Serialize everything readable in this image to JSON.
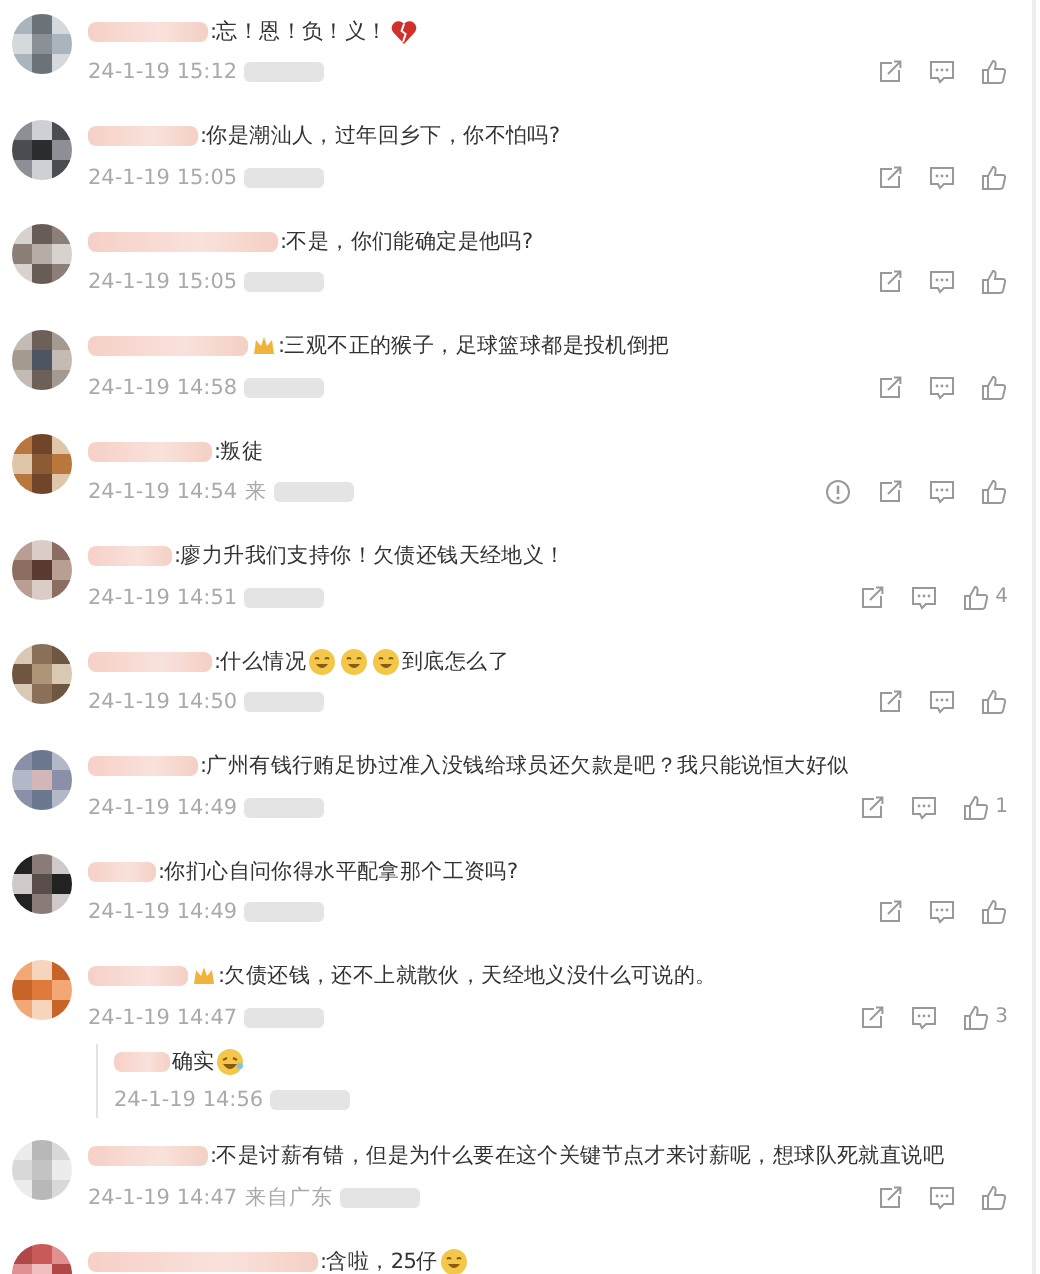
{
  "comments": [
    {
      "badge": false,
      "parts": [
        {
          "kind": "text",
          "text": ":忘！恩！负！义！"
        },
        {
          "kind": "broken-heart"
        }
      ],
      "time": "24-1-19 15:12",
      "actions": [
        {
          "kind": "share"
        },
        {
          "kind": "comment"
        },
        {
          "kind": "like"
        }
      ]
    },
    {
      "badge": false,
      "parts": [
        {
          "kind": "text",
          "text": ":你是潮汕人，过年回乡下，你不怕吗?"
        }
      ],
      "time": "24-1-19 15:05",
      "actions": [
        {
          "kind": "share"
        },
        {
          "kind": "comment"
        },
        {
          "kind": "like"
        }
      ]
    },
    {
      "badge": false,
      "parts": [
        {
          "kind": "text",
          "text": ":不是，你们能确定是他吗?"
        }
      ],
      "time": "24-1-19 15:05",
      "actions": [
        {
          "kind": "share"
        },
        {
          "kind": "comment"
        },
        {
          "kind": "like"
        }
      ]
    },
    {
      "badge": true,
      "parts": [
        {
          "kind": "text",
          "text": ":三观不正的猴子，足球篮球都是投机倒把"
        }
      ],
      "time": "24-1-19 14:58",
      "actions": [
        {
          "kind": "share"
        },
        {
          "kind": "comment"
        },
        {
          "kind": "like"
        }
      ]
    },
    {
      "badge": false,
      "parts": [
        {
          "kind": "text",
          "text": ":叛徒"
        }
      ],
      "time": "24-1-19 14:54",
      "location": "来",
      "actions": [
        {
          "kind": "report"
        },
        {
          "kind": "share"
        },
        {
          "kind": "comment"
        },
        {
          "kind": "like"
        }
      ]
    },
    {
      "badge": false,
      "parts": [
        {
          "kind": "text",
          "text": ":廖力升我们支持你！欠债还钱天经地义！"
        }
      ],
      "time": "24-1-19 14:51",
      "actions": [
        {
          "kind": "share"
        },
        {
          "kind": "comment"
        },
        {
          "kind": "like",
          "count": "4"
        }
      ]
    },
    {
      "badge": false,
      "parts": [
        {
          "kind": "text",
          "text": ":什么情况"
        },
        {
          "kind": "smile"
        },
        {
          "kind": "smile"
        },
        {
          "kind": "smile"
        },
        {
          "kind": "text",
          "text": "到底怎么了"
        }
      ],
      "time": "24-1-19 14:50",
      "actions": [
        {
          "kind": "share"
        },
        {
          "kind": "comment"
        },
        {
          "kind": "like"
        }
      ]
    },
    {
      "badge": false,
      "parts": [
        {
          "kind": "text",
          "text": ":广州有钱行贿足协过准入没钱给球员还欠款是吧？我只能说恒大好似"
        }
      ],
      "time": "24-1-19 14:49",
      "actions": [
        {
          "kind": "share"
        },
        {
          "kind": "comment"
        },
        {
          "kind": "like",
          "count": "1"
        }
      ]
    },
    {
      "badge": false,
      "parts": [
        {
          "kind": "text",
          "text": ":你扪心自问你得水平配拿那个工资吗?"
        }
      ],
      "time": "24-1-19 14:49",
      "actions": [
        {
          "kind": "share"
        },
        {
          "kind": "comment"
        },
        {
          "kind": "like"
        }
      ]
    },
    {
      "badge": true,
      "parts": [
        {
          "kind": "text",
          "text": ":欠债还钱，还不上就散伙，天经地义没什么可说的。"
        }
      ],
      "time": "24-1-19 14:47",
      "actions": [
        {
          "kind": "share"
        },
        {
          "kind": "comment"
        },
        {
          "kind": "like",
          "count": "3"
        }
      ],
      "replies": [
        {
          "parts": [
            {
              "kind": "text",
              "text": "确实"
            },
            {
              "kind": "laugh"
            }
          ],
          "time": "24-1-19 14:56"
        }
      ]
    },
    {
      "badge": false,
      "parts": [
        {
          "kind": "text",
          "text": ":不是讨薪有错，但是为什么要在这个关键节点才来讨薪呢，想球队死就直说吧"
        }
      ],
      "time": "24-1-19 14:47",
      "location": "来自广东",
      "actions": [
        {
          "kind": "share"
        },
        {
          "kind": "comment"
        },
        {
          "kind": "like"
        }
      ]
    },
    {
      "badge": false,
      "parts": [
        {
          "kind": "text",
          "text": ":含啦，25仔"
        },
        {
          "kind": "smile"
        }
      ]
    }
  ]
}
